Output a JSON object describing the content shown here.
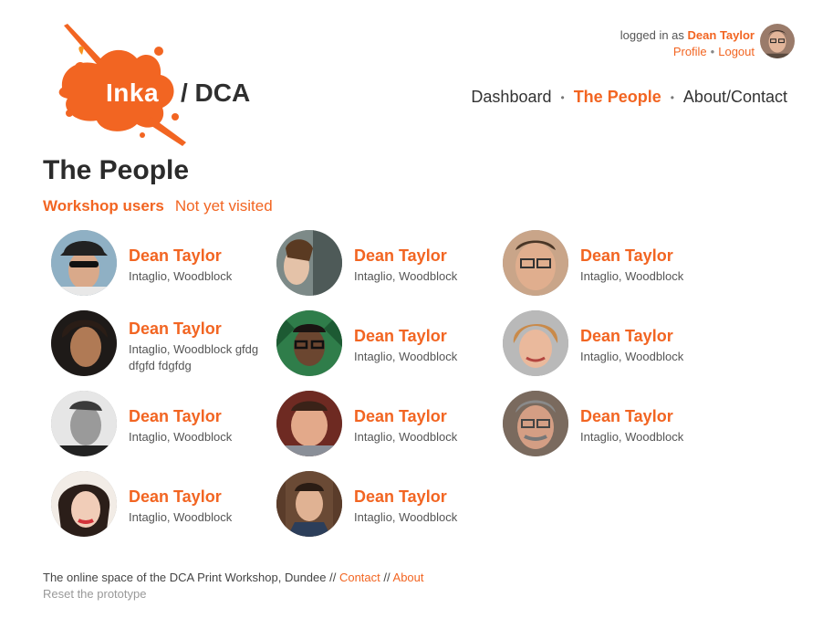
{
  "brand": {
    "logo_text": "Inka",
    "suffix": "/ DCA",
    "accent": "#f26522"
  },
  "userbar": {
    "logged_in_prefix": "logged in as",
    "user_name": "Dean Taylor",
    "profile_label": "Profile",
    "logout_label": "Logout"
  },
  "nav": {
    "items": [
      {
        "label": "Dashboard"
      },
      {
        "label": "The People"
      },
      {
        "label": "About/Contact"
      }
    ]
  },
  "page": {
    "title": "The People"
  },
  "tabs": [
    {
      "label": "Workshop users"
    },
    {
      "label": "Not yet visited"
    }
  ],
  "people": [
    {
      "name": "Dean Taylor",
      "skills": "Intaglio, Woodblock"
    },
    {
      "name": "Dean Taylor",
      "skills": "Intaglio, Woodblock"
    },
    {
      "name": "Dean Taylor",
      "skills": "Intaglio, Woodblock"
    },
    {
      "name": "Dean Taylor",
      "skills": "Intaglio, Woodblock gfdg dfgfd fdgfdg"
    },
    {
      "name": "Dean Taylor",
      "skills": "Intaglio, Woodblock"
    },
    {
      "name": "Dean Taylor",
      "skills": "Intaglio, Woodblock"
    },
    {
      "name": "Dean Taylor",
      "skills": "Intaglio, Woodblock"
    },
    {
      "name": "Dean Taylor",
      "skills": "Intaglio, Woodblock"
    },
    {
      "name": "Dean Taylor",
      "skills": "Intaglio, Woodblock"
    },
    {
      "name": "Dean Taylor",
      "skills": "Intaglio, Woodblock"
    },
    {
      "name": "Dean Taylor",
      "skills": "Intaglio, Woodblock"
    }
  ],
  "footer": {
    "text": "The online space of the DCA Print Workshop, Dundee //",
    "contact_label": "Contact",
    "separator": "//",
    "about_label": "About",
    "reset_label": "Reset the prototype"
  }
}
